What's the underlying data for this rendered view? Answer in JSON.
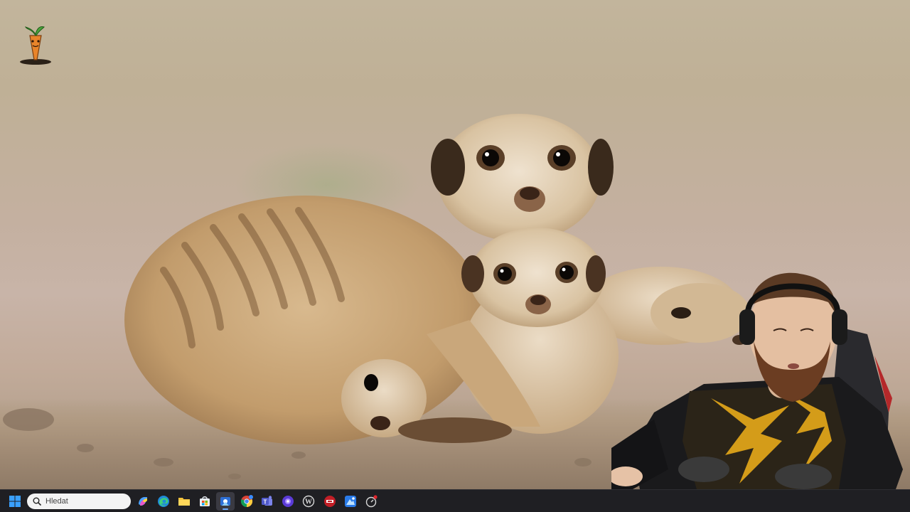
{
  "taskbar": {
    "search_placeholder": "Hledat",
    "icons": [
      "windows-start-icon",
      "search-icon",
      "copilot-icon",
      "edge-browser-icon",
      "file-explorer-icon",
      "microsoft-store-icon",
      "app-icon",
      "chrome-icon",
      "teams-icon",
      "app-icon",
      "wordpress-icon",
      "app-icon",
      "app-icon",
      "app-icon"
    ]
  }
}
